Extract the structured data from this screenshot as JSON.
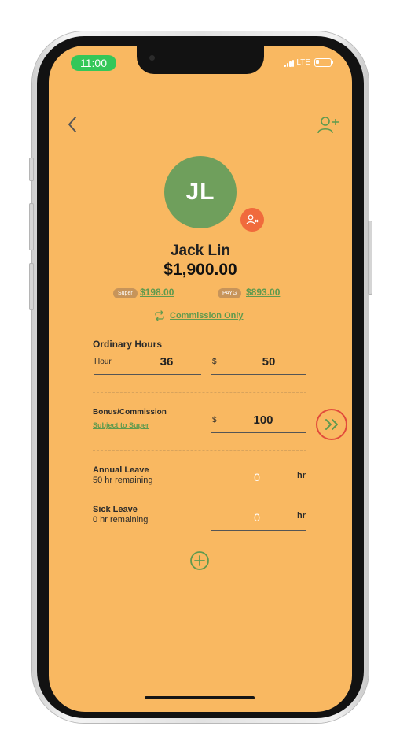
{
  "status_bar": {
    "time": "11:00",
    "network": "LTE"
  },
  "employee": {
    "initials": "JL",
    "name": "Jack Lin",
    "total": "$1,900.00"
  },
  "tax": {
    "super_label": "Super",
    "super_amount": "$198.00",
    "payg_label": "PAYG",
    "payg_amount": "$893.00"
  },
  "pay_type": {
    "label": "Commission Only"
  },
  "ordinary_hours": {
    "title": "Ordinary Hours",
    "hour_label": "Hour",
    "hours": "36",
    "currency": "$",
    "rate": "50"
  },
  "bonus": {
    "title": "Bonus/Commission",
    "subject_link": "Subject to Super",
    "currency": "$",
    "amount": "100"
  },
  "annual_leave": {
    "title": "Annual Leave",
    "remaining": "50 hr remaining",
    "value": "0",
    "unit": "hr"
  },
  "sick_leave": {
    "title": "Sick Leave",
    "remaining": "0 hr remaining",
    "value": "0",
    "unit": "hr"
  },
  "icons": {
    "back": "chevron-left-icon",
    "add_user": "add-user-icon",
    "remove_user": "remove-user-icon",
    "commission_toggle": "repeat-icon",
    "next": "double-chevron-right-icon",
    "add": "plus-circle-icon"
  },
  "colors": {
    "background": "#f9b861",
    "accent_green": "#6f9f5c",
    "link_green": "#5f9a4e",
    "danger": "#f06a3c",
    "highlight_ring": "#e24b3b"
  }
}
